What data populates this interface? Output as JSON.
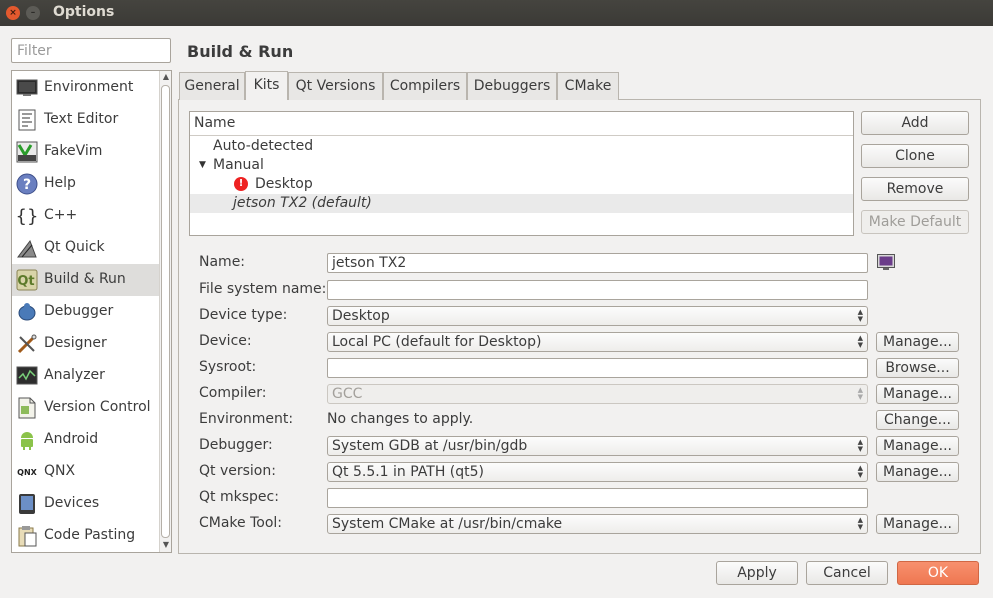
{
  "window": {
    "title": "Options",
    "close_glyph": "×",
    "min_glyph": "–"
  },
  "filter": {
    "placeholder": "Filter",
    "value": ""
  },
  "categories": [
    {
      "label": "Environment",
      "icon": "monitor-icon"
    },
    {
      "label": "Text Editor",
      "icon": "text-document-icon"
    },
    {
      "label": "FakeVim",
      "icon": "fakevim-icon"
    },
    {
      "label": "Help",
      "icon": "help-icon"
    },
    {
      "label": "C++",
      "icon": "braces-icon"
    },
    {
      "label": "Qt Quick",
      "icon": "qtquick-icon"
    },
    {
      "label": "Build & Run",
      "icon": "build-run-icon",
      "selected": true
    },
    {
      "label": "Debugger",
      "icon": "debugger-icon"
    },
    {
      "label": "Designer",
      "icon": "designer-icon"
    },
    {
      "label": "Analyzer",
      "icon": "analyzer-icon"
    },
    {
      "label": "Version Control",
      "icon": "version-control-icon"
    },
    {
      "label": "Android",
      "icon": "android-icon"
    },
    {
      "label": "QNX",
      "icon": "qnx-icon"
    },
    {
      "label": "Devices",
      "icon": "devices-icon"
    },
    {
      "label": "Code Pasting",
      "icon": "code-pasting-icon"
    }
  ],
  "page": {
    "title": "Build & Run"
  },
  "tabs": [
    {
      "label": "General"
    },
    {
      "label": "Kits",
      "active": true
    },
    {
      "label": "Qt Versions"
    },
    {
      "label": "Compilers"
    },
    {
      "label": "Debuggers"
    },
    {
      "label": "CMake"
    }
  ],
  "tree": {
    "header": "Name",
    "rows": [
      {
        "label": "Auto-detected"
      },
      {
        "label": "Manual",
        "expanded": true
      },
      {
        "label": "Desktop",
        "error": true,
        "error_glyph": "!"
      },
      {
        "label": "jetson TX2 (default)",
        "selected": true
      }
    ]
  },
  "kit_buttons": {
    "add": "Add",
    "clone": "Clone",
    "remove": "Remove",
    "make_default": "Make Default"
  },
  "form": {
    "name": {
      "label": "Name:",
      "value": "jetson TX2"
    },
    "fs_name": {
      "label": "File system name:",
      "value": ""
    },
    "device_type": {
      "label": "Device type:",
      "value": "Desktop"
    },
    "device": {
      "label": "Device:",
      "value": "Local PC (default for Desktop)",
      "button": "Manage..."
    },
    "sysroot": {
      "label": "Sysroot:",
      "value": "",
      "button": "Browse..."
    },
    "compiler": {
      "label": "Compiler:",
      "value": "GCC",
      "button": "Manage..."
    },
    "environment": {
      "label": "Environment:",
      "value": "No changes to apply.",
      "button": "Change..."
    },
    "debugger": {
      "label": "Debugger:",
      "value": "System GDB at /usr/bin/gdb",
      "button": "Manage..."
    },
    "qt_version": {
      "label": "Qt version:",
      "value": "Qt 5.5.1 in PATH (qt5)",
      "button": "Manage..."
    },
    "qt_mkspec": {
      "label": "Qt mkspec:",
      "value": ""
    },
    "cmake_tool": {
      "label": "CMake Tool:",
      "value": "System CMake at /usr/bin/cmake",
      "button": "Manage..."
    }
  },
  "footer": {
    "apply": "Apply",
    "cancel": "Cancel",
    "ok": "OK"
  },
  "colors": {
    "titlebar": "#3b3a36",
    "ok_button": "#ef7751",
    "selection": "#dedddb",
    "window_bg": "#f2f1f0"
  }
}
